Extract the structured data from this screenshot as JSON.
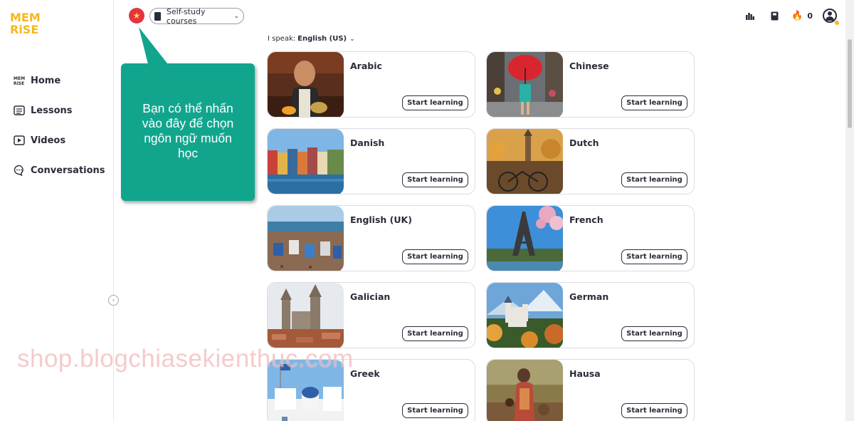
{
  "sidebar": {
    "logo": [
      "MEM",
      "RiSE"
    ],
    "items": [
      {
        "label": "Home",
        "icon": "memrise-logo-icon"
      },
      {
        "label": "Lessons",
        "icon": "lessons-icon"
      },
      {
        "label": "Videos",
        "icon": "video-icon"
      },
      {
        "label": "Conversations",
        "icon": "chat-icon"
      }
    ]
  },
  "topbar": {
    "flag_icon": "vietnam-flag-icon",
    "course_select": "Self-study courses",
    "streak_count": "0"
  },
  "speak": {
    "label": "I speak:",
    "value": "English (US)"
  },
  "courses": [
    {
      "name": "Arabic",
      "button": "Start learning"
    },
    {
      "name": "Chinese",
      "button": "Start learning"
    },
    {
      "name": "Danish",
      "button": "Start learning"
    },
    {
      "name": "Dutch",
      "button": "Start learning"
    },
    {
      "name": "English (UK)",
      "button": "Start learning"
    },
    {
      "name": "French",
      "button": "Start learning"
    },
    {
      "name": "Galician",
      "button": "Start learning"
    },
    {
      "name": "German",
      "button": "Start learning"
    },
    {
      "name": "Greek",
      "button": "Start learning"
    },
    {
      "name": "Hausa",
      "button": "Start learning"
    }
  ],
  "callout": {
    "text": "Bạn có thể nhấn vào đây để chọn ngôn ngữ muốn học"
  },
  "watermark": "shop.blogchiasekienthuc.com",
  "colors": {
    "brand": "#f6b81d",
    "callout": "#12a58e",
    "flag": "#e3343f"
  }
}
